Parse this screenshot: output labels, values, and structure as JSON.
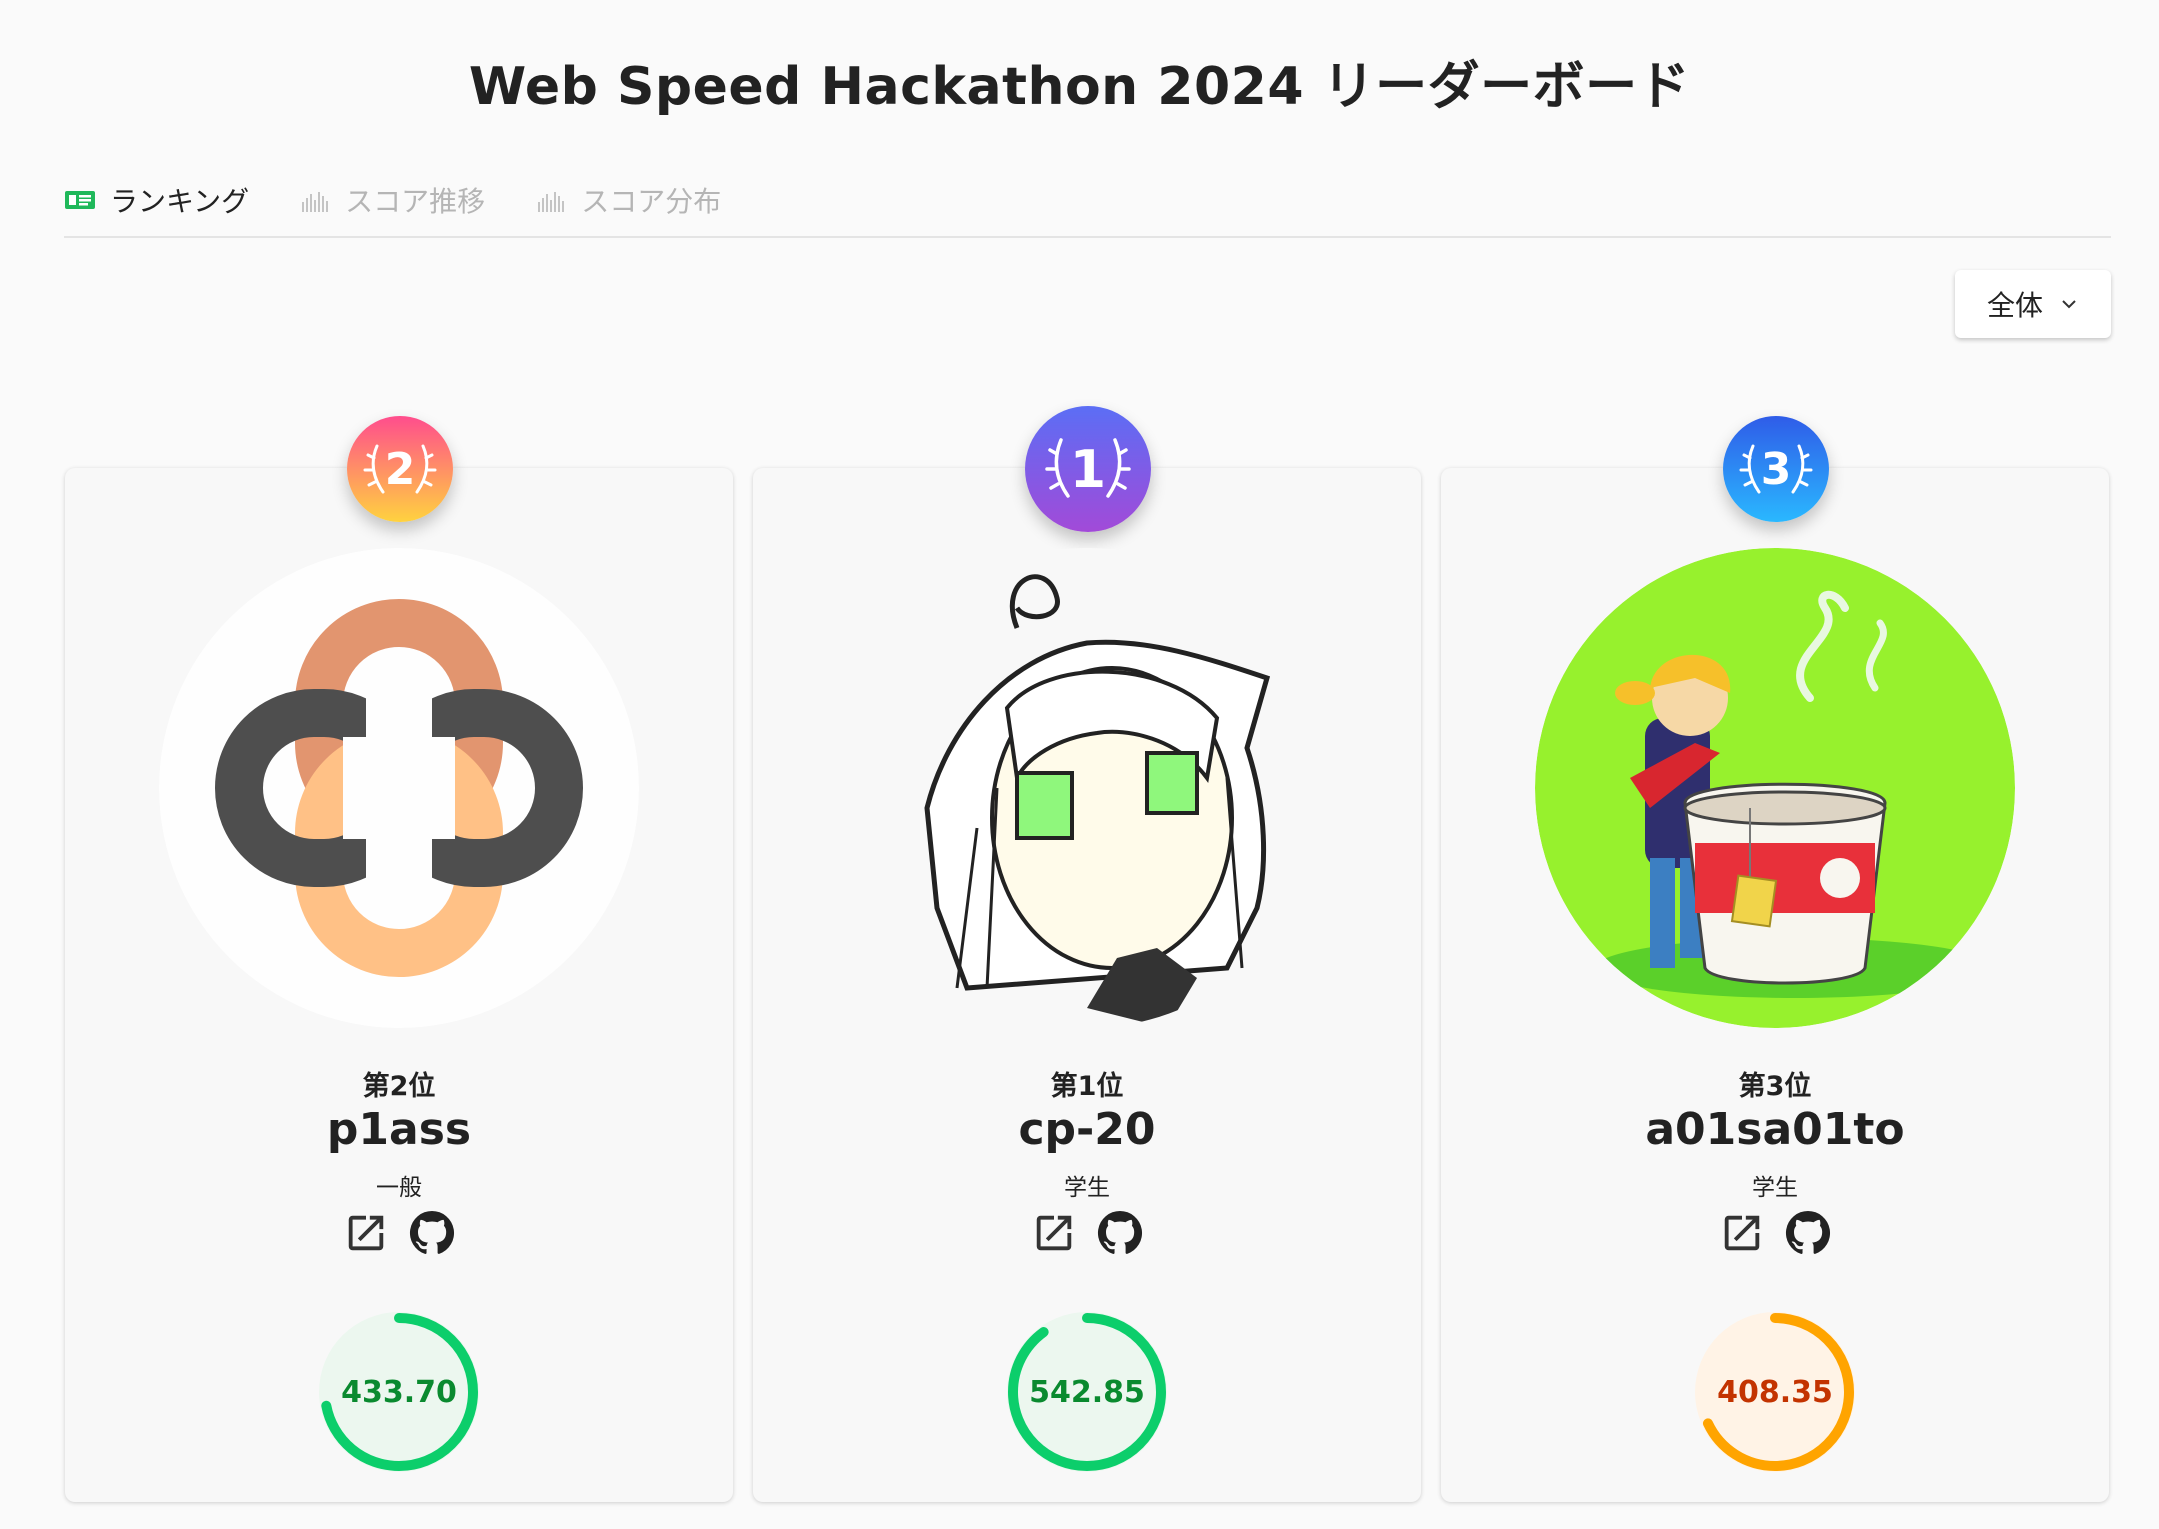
{
  "title": "Web Speed Hackathon 2024 リーダーボード",
  "tabs": [
    {
      "label": "ランキング",
      "icon": "ranking-card-icon",
      "active": true
    },
    {
      "label": "スコア推移",
      "icon": "bar-chart-icon",
      "active": false
    },
    {
      "label": "スコア分布",
      "icon": "bar-chart-icon",
      "active": false
    }
  ],
  "filter": {
    "label": "全体",
    "icon": "chevron-down-icon"
  },
  "cards": [
    {
      "rank": 2,
      "rank_label": "第2位",
      "name": "p1ass",
      "category": "一般",
      "score": "433.70",
      "score_fraction": 0.72,
      "score_color": "#0a8a2f",
      "ring_color": "#0cce6b",
      "ring_bg": "#ecf7ef",
      "medal_colors": [
        "#ff4d8d",
        "#ffd23f"
      ]
    },
    {
      "rank": 1,
      "rank_label": "第1位",
      "name": "cp-20",
      "category": "学生",
      "score": "542.85",
      "score_fraction": 0.9,
      "score_color": "#0a8a2f",
      "ring_color": "#0cce6b",
      "ring_bg": "#ecf7ef",
      "medal_colors": [
        "#5b6ef5",
        "#a24ad8"
      ]
    },
    {
      "rank": 3,
      "rank_label": "第3位",
      "name": "a01sa01to",
      "category": "学生",
      "score": "408.35",
      "score_fraction": 0.68,
      "score_color": "#c33300",
      "ring_color": "#ffa400",
      "ring_bg": "#fff3e6",
      "medal_colors": [
        "#2f5ce8",
        "#2ab8ff"
      ]
    }
  ]
}
